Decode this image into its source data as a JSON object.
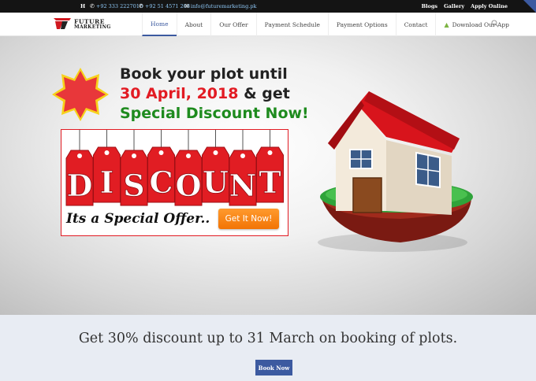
{
  "topbar": {
    "h": "H",
    "phone1": "+92 333 2227010",
    "phone2": "+92 51 4571 208",
    "email": "info@futuremarketing.pk",
    "links": [
      "Blogs",
      "Gallery",
      "Apply Online"
    ]
  },
  "logo": {
    "line1": "FUTURE",
    "line2": "MARKETING"
  },
  "nav": {
    "items": [
      "Home",
      "About",
      "Our Offer",
      "Payment Schedule",
      "Payment Options",
      "Contact",
      "Download Our App"
    ],
    "active": "Home"
  },
  "hero": {
    "line1": "Book your plot until",
    "line2_date": "30 April, 2018",
    "line2_rest": " & get",
    "line3": "Special Discount Now!",
    "tag_letters": [
      "D",
      "I",
      "S",
      "C",
      "O",
      "U",
      "N",
      "T"
    ],
    "offer_text": "Its a Special Offer..",
    "cta": "Get It Now!"
  },
  "band": {
    "message": "Get 30% discount up to 31 March on booking of plots.",
    "button": "Book Now"
  },
  "colors": {
    "accent": "#3c5aa0",
    "red": "#e21b23",
    "green": "#1e8b1e",
    "orange": "#f27405"
  },
  "icons": [
    "phone-icon",
    "email-icon",
    "android-icon",
    "search-icon",
    "star-burst-icon",
    "house-illustration"
  ]
}
